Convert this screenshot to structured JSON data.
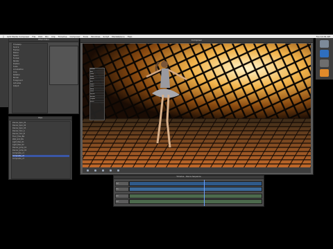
{
  "menubar": {
    "app": "Avid Media Composer",
    "items": [
      "File",
      "Edit",
      "Bin",
      "Clip",
      "Timeline",
      "Composer",
      "Tools",
      "Windows",
      "Script",
      "Marketplace",
      "Help"
    ],
    "clock": "Tue 10:34 AM"
  },
  "project_window": {
    "title": "Effect Editor",
    "rows": [
      "Timewarp",
      "Source",
      "Frames",
      "Motion",
      "Speed",
      "Format",
      "Render",
      "Position",
      "Scale",
      "Acceleration",
      "Crop",
      "Rotation",
      "Border",
      "Foreground",
      "Anti-alias",
      "Output"
    ]
  },
  "bin_window": {
    "title": "Clips",
    "rows": [
      "Dancer_Spin_01",
      "Dancer_Spin_02",
      "Dancer_Spin_03",
      "Dancer_Turn_A",
      "Dancer_Turn_B",
      "Floor_Tiles_BG",
      "Wall_Grid_BG",
      "Light_Pass_01",
      "Light_Pass_02",
      "Dancer_Jump_01",
      "Dancer_Jump_02",
      "Composite_v1",
      "Composite_v2",
      "Composite_v3"
    ],
    "selected_row": 12
  },
  "viewer": {
    "title": "Composer",
    "effect_menu": [
      "Motion",
      "Blur",
      "Color",
      "Mask",
      "Matte",
      "Key",
      "Layer",
      "Track",
      "Warp",
      "Glow",
      "Stylize",
      "Render",
      "Output",
      "Reset"
    ]
  },
  "timeline": {
    "title": "Timeline - Dance Sequence",
    "tracks": [
      "V2",
      "V1",
      "A1",
      "A2"
    ]
  },
  "colors": {
    "menubar_bg": "#e9e9e9",
    "panel_bg": "#4a4a4a",
    "selection": "#3a57a8",
    "tile_orange": "#e08a2a"
  },
  "icons": [
    "apple-icon",
    "play-icon",
    "stop-icon",
    "rewind-icon",
    "forward-icon",
    "gear-icon"
  ]
}
